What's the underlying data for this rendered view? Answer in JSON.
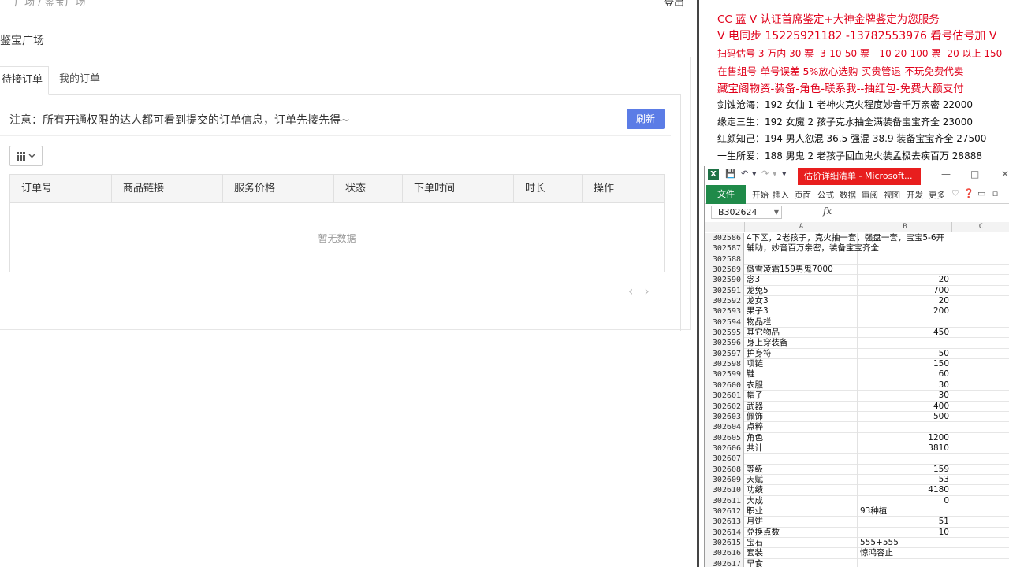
{
  "web": {
    "breadcrumb": [
      "广场",
      "鉴宝广场"
    ],
    "logout": "登出",
    "page_title": "鉴宝广场",
    "tabs": [
      {
        "label": "待接订单"
      },
      {
        "label": "我的订单"
      }
    ],
    "notice": "注意：所有开通权限的达人都可看到提交的订单信息，订单先接先得~",
    "refresh_label": "刷新",
    "table": {
      "columns": [
        "订单号",
        "商品链接",
        "服务价格",
        "状态",
        "下单时间",
        "时长",
        "操作"
      ],
      "empty_text": "暂无数据"
    },
    "pager": {
      "prev": "‹",
      "next": "›"
    }
  },
  "notes": [
    {
      "text": "CC 蓝 V 认证首席鉴定+大神金牌鉴定为您服务",
      "color": "#e0001a"
    },
    {
      "text": "V 电同步 15225921182 -13782553976 看号估号加 V",
      "color": "#e0001a"
    },
    {
      "text": "扫码估号 3 万内 30 票- 3-10-50 票 --10-20-100 票- 20 以上 150",
      "color": "#e0001a"
    },
    {
      "text": "在售组号-单号误差 5%放心选购-买贵管退-不玩免费代卖",
      "color": "#e0001a"
    },
    {
      "text": "藏宝阁物资-装备-角色-联系我--抽红包-免费大额支付",
      "color": "#e0001a"
    },
    {
      "text": "剑蚀沧海：192 女仙 1 老神火克火程度妙音千万亲密 22000",
      "color": "#111111"
    },
    {
      "text": "缘定三生：192 女魔 2 孩子克水抽全满装备宝宝齐全 23000",
      "color": "#111111"
    },
    {
      "text": "红颜知己：194 男人忽混 36.5 强混 38.9 装备宝宝齐全 27500",
      "color": "#111111"
    },
    {
      "text": "一生所爱：188 男鬼 2 老孩子回血鬼火装孟极去疾百万 28888",
      "color": "#111111"
    }
  ],
  "excel": {
    "window_title": "估价详细清单 - Microsoft...",
    "ribbon_tabs": [
      "文件",
      "开始",
      "插入",
      "页面",
      "公式",
      "数据",
      "审阅",
      "视图",
      "开发",
      "更多"
    ],
    "name_box": "B302624",
    "fx_label": "fx",
    "columns": [
      "A",
      "B",
      "C"
    ],
    "rows": [
      {
        "n": "302586",
        "a": "4下区，2老孩子，克火抽一套，强盘一套，宝宝5-6开",
        "b": ""
      },
      {
        "n": "302587",
        "a": "辅助，妙音百万亲密，装备宝宝齐全",
        "b": ""
      },
      {
        "n": "302588",
        "a": "",
        "b": ""
      },
      {
        "n": "302589",
        "a": "傲雪凌霜159男鬼7000",
        "b": ""
      },
      {
        "n": "302590",
        "a": "念3",
        "b": "20"
      },
      {
        "n": "302591",
        "a": "龙兔5",
        "b": "700"
      },
      {
        "n": "302592",
        "a": "龙女3",
        "b": "20"
      },
      {
        "n": "302593",
        "a": "果子3",
        "b": "200"
      },
      {
        "n": "302594",
        "a": "物品栏",
        "b": ""
      },
      {
        "n": "302595",
        "a": "其它物品",
        "b": "450"
      },
      {
        "n": "302596",
        "a": "身上穿装备",
        "b": ""
      },
      {
        "n": "302597",
        "a": "护身符",
        "b": "50"
      },
      {
        "n": "302598",
        "a": "项链",
        "b": "150"
      },
      {
        "n": "302599",
        "a": "鞋",
        "b": "60"
      },
      {
        "n": "302600",
        "a": "衣服",
        "b": "30"
      },
      {
        "n": "302601",
        "a": "帽子",
        "b": "30"
      },
      {
        "n": "302602",
        "a": "武器",
        "b": "400"
      },
      {
        "n": "302603",
        "a": "佩饰",
        "b": "500"
      },
      {
        "n": "302604",
        "a": "点粹",
        "b": ""
      },
      {
        "n": "302605",
        "a": "角色",
        "b": "1200"
      },
      {
        "n": "302606",
        "a": "共计",
        "b": "3810"
      },
      {
        "n": "302607",
        "a": "",
        "b": ""
      },
      {
        "n": "302608",
        "a": "等级",
        "b": "159"
      },
      {
        "n": "302609",
        "a": "天赋",
        "b": "53"
      },
      {
        "n": "302610",
        "a": "功绩",
        "b": "4180"
      },
      {
        "n": "302611",
        "a": "大成",
        "b": "0"
      },
      {
        "n": "302612",
        "a": "职业",
        "b": "93种植",
        "left": true
      },
      {
        "n": "302613",
        "a": "月饼",
        "b": "51"
      },
      {
        "n": "302614",
        "a": "兑换点数",
        "b": "10"
      },
      {
        "n": "302615",
        "a": "宝石",
        "b": "555+555",
        "left": true
      },
      {
        "n": "302616",
        "a": "套装",
        "b": "惊鸿容止",
        "left": true
      },
      {
        "n": "302617",
        "a": "早食",
        "b": ""
      }
    ]
  },
  "colors": {
    "accent": "#5b7ce6",
    "excel_green": "#1f8a49",
    "title_red": "#e81e1e"
  }
}
